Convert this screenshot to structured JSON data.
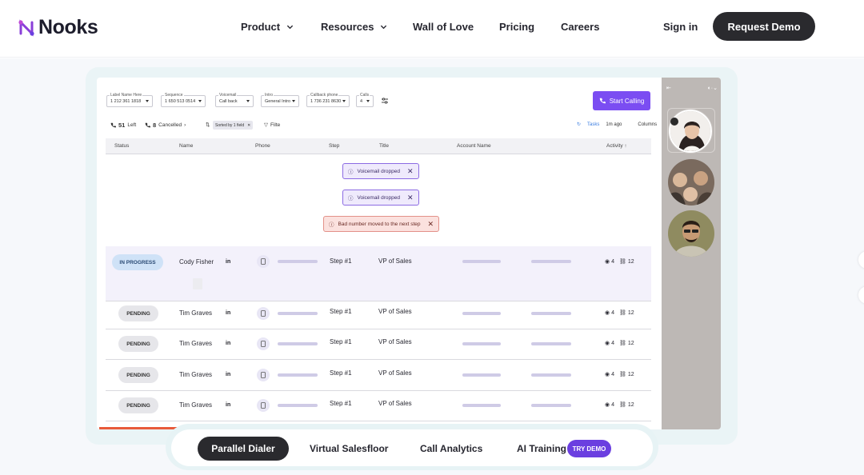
{
  "nav": {
    "logo_text": "Nooks",
    "links": [
      "Product",
      "Resources",
      "Wall of Love",
      "Pricing",
      "Careers"
    ],
    "sign_in": "Sign in",
    "cta": "Request Demo"
  },
  "toolbar": {
    "fields": [
      {
        "label": "Label Name Here",
        "value": "1 212 361 1818"
      },
      {
        "label": "Sequence",
        "value": "1 650 513 0514"
      },
      {
        "label": "Voicemail",
        "value": "Call back"
      },
      {
        "label": "Intro",
        "value": "General Intro"
      },
      {
        "label": "Callback phone",
        "value": "1 736 231 8630"
      },
      {
        "label": "Calls",
        "value": "4"
      }
    ],
    "start_calling": "Start Calling"
  },
  "subbar": {
    "left_count": "51",
    "left_label": "Left",
    "cancelled_count": "8",
    "cancelled_label": "Cancelled",
    "sort_chip": "Sorted by 1 field",
    "filter": "Filte",
    "tasks": "Tasks",
    "tasks_time": "1m ago",
    "columns": "Columns"
  },
  "table": {
    "headers": [
      "Status",
      "Name",
      "Phone",
      "Step",
      "Title",
      "Account Name",
      "Activity"
    ],
    "toasts": {
      "vm1": "Voicemail dropped",
      "vm2": "Voicemail dropped",
      "bad": "Bad number moved to the next step"
    },
    "rows": [
      {
        "status": "IN PROGRESS",
        "name": "Cody Fisher",
        "li": "in",
        "step": "Step #1",
        "title": "VP of Sales",
        "views": "4",
        "links": "12"
      },
      {
        "status": "PENDING",
        "name": "Tim Graves",
        "li": "in",
        "step": "Step #1",
        "title": "VP of Sales",
        "views": "4",
        "links": "12"
      },
      {
        "status": "PENDING",
        "name": "Tim Graves",
        "li": "in",
        "step": "Step #1",
        "title": "VP of Sales",
        "views": "4",
        "links": "12"
      },
      {
        "status": "PENDING",
        "name": "Tim Graves",
        "li": "in",
        "step": "Step #1",
        "title": "VP of Sales",
        "views": "4",
        "links": "12"
      },
      {
        "status": "PENDING",
        "name": "Tim Graves",
        "li": "in",
        "step": "Step #1",
        "title": "VP of Sales",
        "views": "4",
        "links": "12"
      }
    ]
  },
  "video_panel": {
    "collapse_icon": "collapse-icon",
    "mic_icon": "mic-icon"
  },
  "tabs": {
    "items": [
      "Parallel Dialer",
      "Virtual Salesfloor",
      "Call Analytics",
      "AI Training"
    ],
    "active": "Parallel Dialer",
    "badge": "TRY DEMO"
  },
  "colors": {
    "brand_purple": "#7b4df2",
    "dark_button": "#2a2a2e",
    "badge_purple": "#6b3fe0"
  }
}
